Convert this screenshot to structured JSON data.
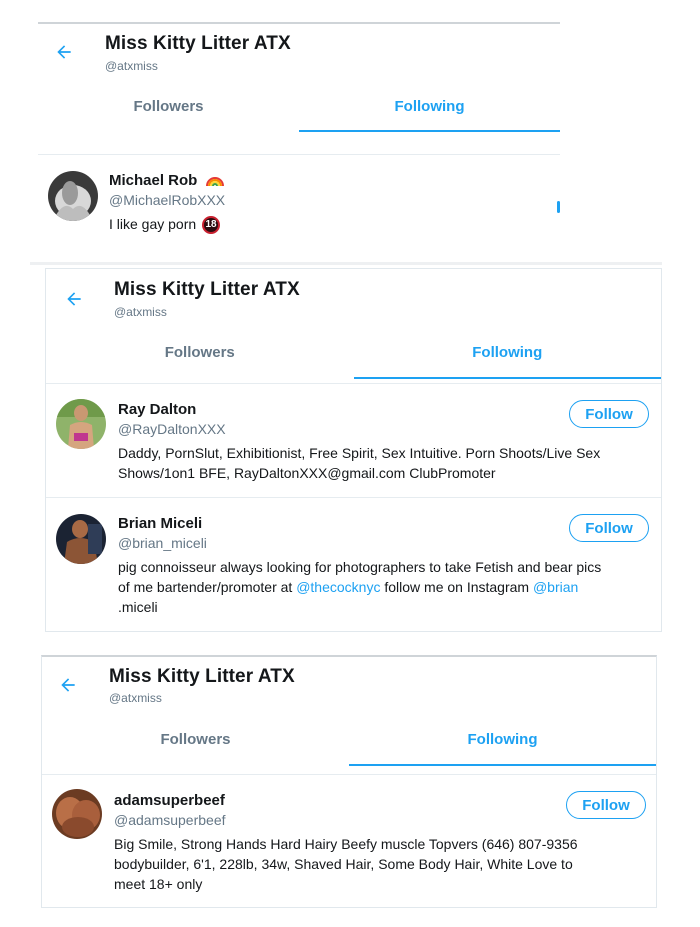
{
  "profile": {
    "name": "Miss Kitty Litter ATX",
    "handle": "@atxmiss"
  },
  "tabs": {
    "followers": "Followers",
    "following": "Following"
  },
  "follow_label": "Follow",
  "colors": {
    "accent": "#1da1f2",
    "secondary_text": "#657786",
    "primary_text": "#14171a",
    "border": "#e1e8ed"
  },
  "screenshot1": {
    "user": {
      "name": "Michael Rob",
      "name_emoji": "rainbow-emoji",
      "handle": "@MichaelRobXXX",
      "bio": "I like gay porn",
      "bio_badge": "18"
    }
  },
  "screenshot2": {
    "users": [
      {
        "name": "Ray Dalton",
        "handle": "@RayDaltonXXX",
        "bio_lines": [
          "Daddy, PornSlut, Exhibitionist, Free Spirit, Sex Intuitive. Porn Shoots/Live Sex",
          "Shows/1on1 BFE, RayDaltonXXX@gmail.com ClubPromoter"
        ]
      },
      {
        "name": "Brian Miceli",
        "handle": "@brian_miceli",
        "bio_line1": "pig connoisseur always looking for photographers to take Fetish and bear pics",
        "bio_line2_pre": "of me bartender/promoter at ",
        "bio_mention1": "@thecocknyc",
        "bio_line2_mid": " follow me on Instagram ",
        "bio_mention2": "@brian",
        "bio_line3": ".miceli"
      }
    ]
  },
  "screenshot3": {
    "user": {
      "name": "adamsuperbeef",
      "handle": "@adamsuperbeef",
      "bio_lines": [
        "Big Smile, Strong Hands Hard Hairy Beefy muscle Topvers (646) 807-9356",
        "bodybuilder, 6'1, 228lb, 34w, Shaved Hair, Some Body Hair, White Love to",
        "meet 18+ only"
      ]
    }
  }
}
